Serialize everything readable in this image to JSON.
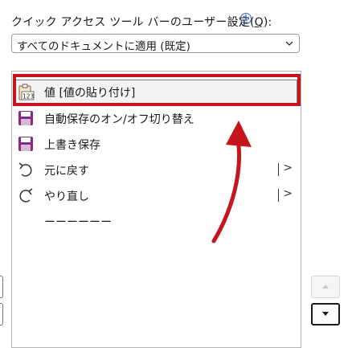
{
  "header": {
    "label_before": "クイック アクセス ツール バーのユーザー設定(",
    "label_accel": "Q",
    "label_after": "):",
    "info_icon": "i"
  },
  "scope_dropdown": {
    "selected": "すべてのドキュメントに適用 (既定)"
  },
  "qat_items": [
    {
      "label": "値 [値の貼り付け]",
      "icon": "paste-values-icon",
      "selected": true
    },
    {
      "label": "自動保存のオン/オフ切り替え",
      "icon": "autosave-icon"
    },
    {
      "label": "上書き保存",
      "icon": "save-icon"
    },
    {
      "label": "元に戻す",
      "icon": "undo-icon",
      "submenu": "|>"
    },
    {
      "label": "やり直し",
      "icon": "redo-icon",
      "submenu": "|>"
    },
    {
      "label": "ーーーーーー",
      "icon": "separator"
    }
  ],
  "colors": {
    "accent_red": "#c4161c",
    "save_purple": "#8a2b8c",
    "info_blue": "#2b63c6"
  }
}
